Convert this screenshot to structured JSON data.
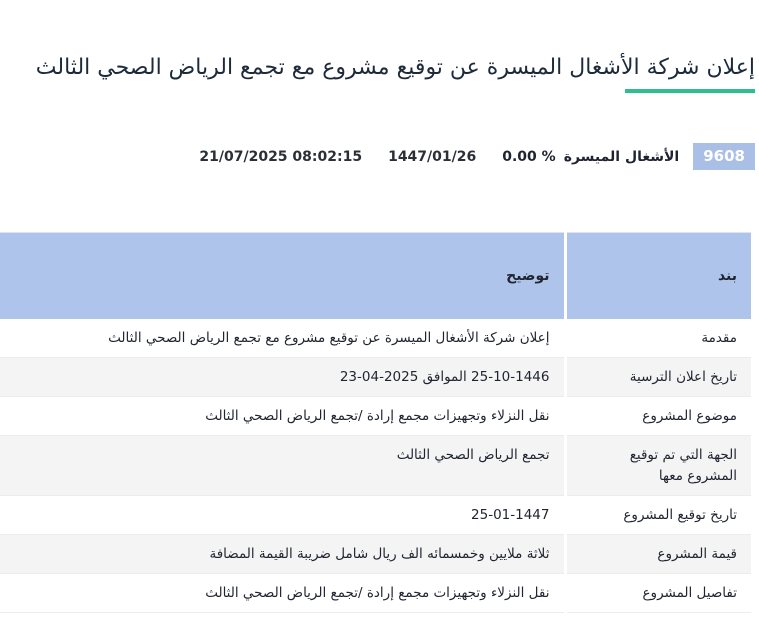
{
  "page_title": "إعلان شركة الأشغال الميسرة عن توقيع مشروع مع تجمع الرياض الصحي الثالث",
  "colors": {
    "accent_underline": "#2fbf8f",
    "badge_bg": "#a9bfe6",
    "table_header_bg": "#afc4ea"
  },
  "meta": {
    "symbol": "9608",
    "company": "الأشغال الميسرة",
    "change": "0.00 %",
    "hijri_date": "1447/01/26",
    "gregorian_datetime": "21/07/2025 08:02:15"
  },
  "table": {
    "headers": {
      "item": "بند",
      "description": "توضيح"
    },
    "rows": [
      {
        "item": "مقدمة",
        "description": "إعلان شركة الأشغال الميسرة عن توقيع مشروع مع تجمع الرياض الصحي الثالث"
      },
      {
        "item": "تاريخ اعلان الترسية",
        "description": "25-10-1446 الموافق 2025-04-23"
      },
      {
        "item": "موضوع المشروع",
        "description": "نقل النزلاء وتجهيزات مجمع إرادة /تجمع الرياض الصحي الثالث"
      },
      {
        "item": "الجهة التي تم توقيع المشروع معها",
        "description": "تجمع الرياض الصحي الثالث"
      },
      {
        "item": "تاريخ توقيع المشروع",
        "description": "25-01-1447"
      },
      {
        "item": "قيمة المشروع",
        "description": "ثلاثة ملايين وخمسمائه الف ريال شامل ضريبة القيمة المضافة"
      },
      {
        "item": "تفاصيل المشروع",
        "description": "نقل النزلاء وتجهيزات مجمع إرادة /تجمع الرياض الصحي الثالث"
      }
    ]
  }
}
